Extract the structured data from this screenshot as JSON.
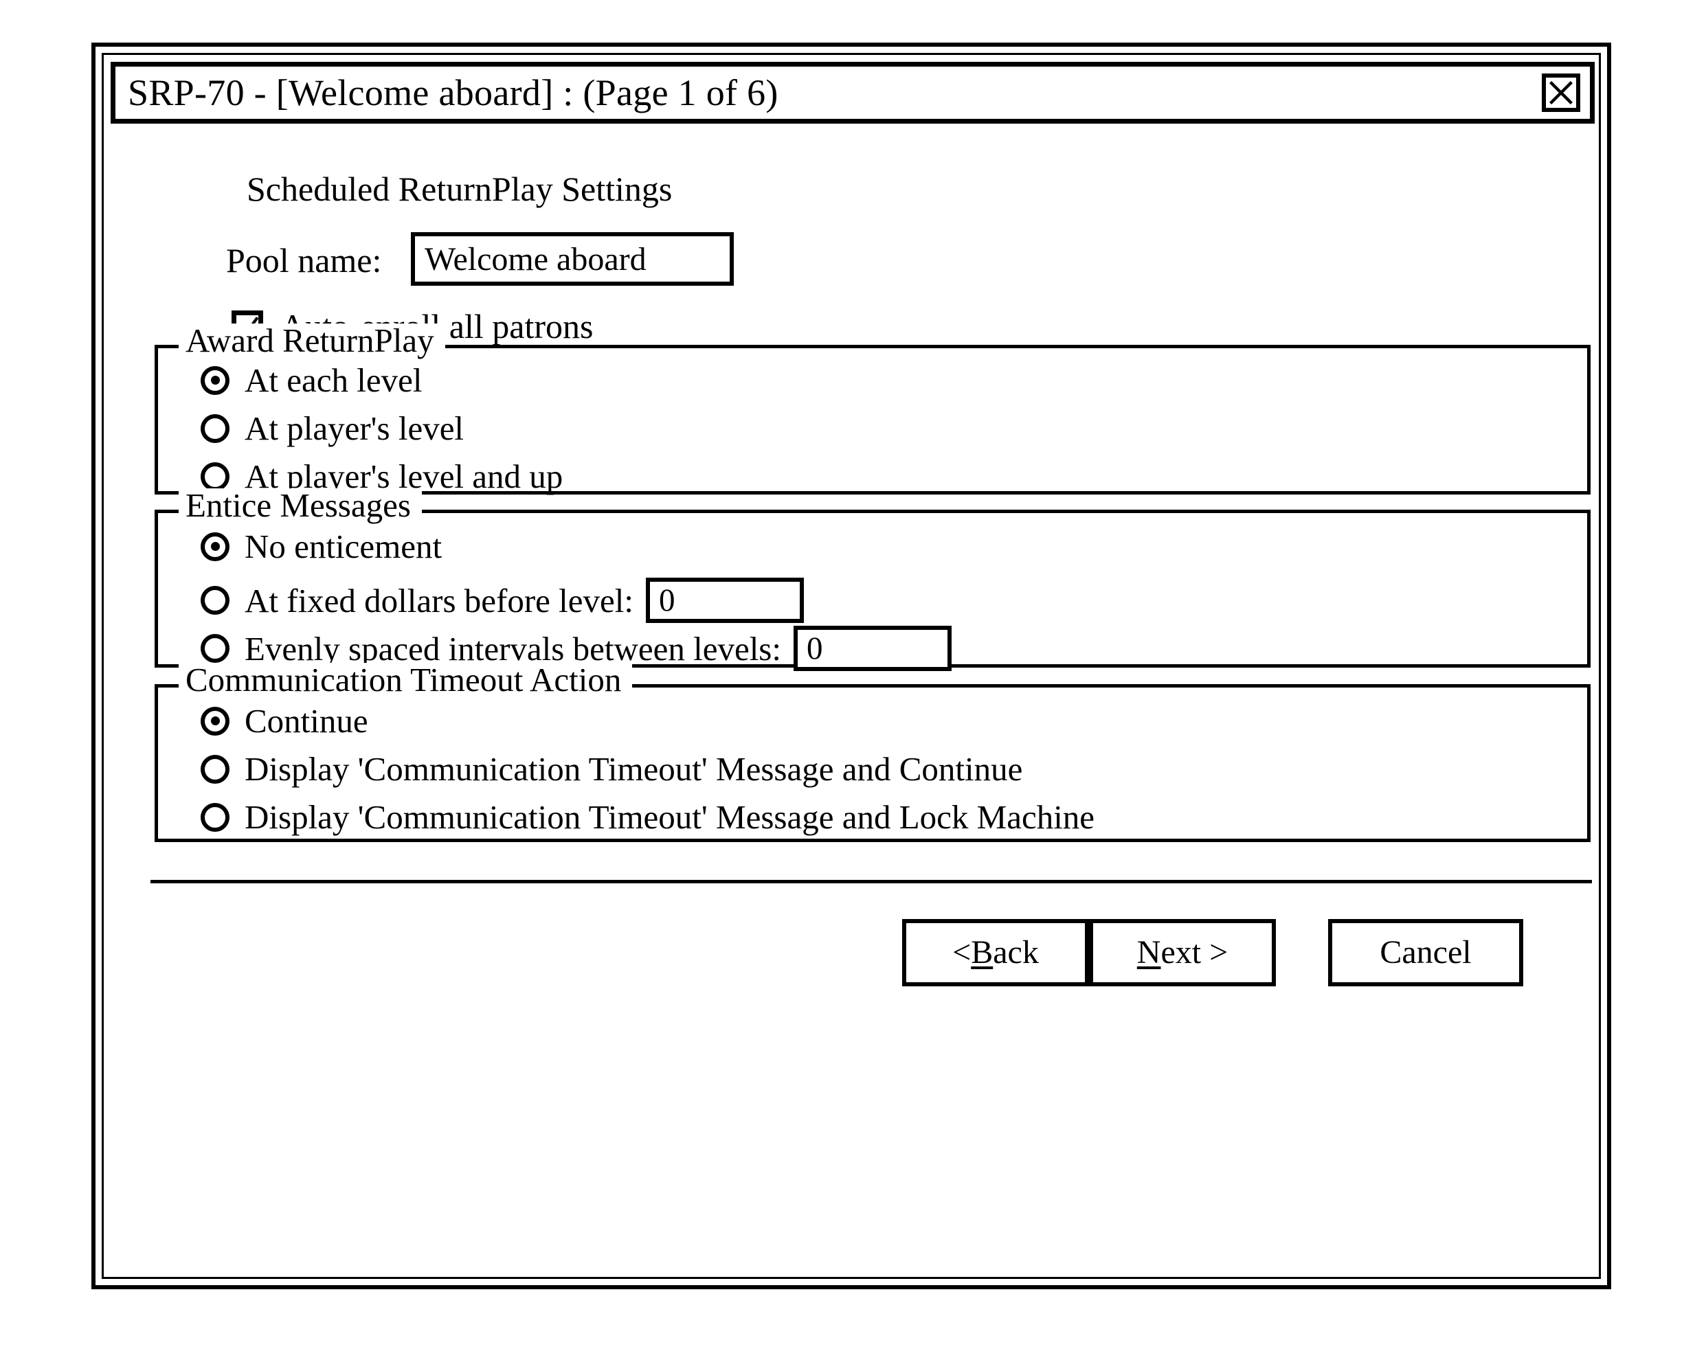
{
  "window": {
    "title": "SRP-70 - [Welcome aboard] : (Page 1 of 6)",
    "close_icon": "close-x-icon"
  },
  "heading": "Scheduled ReturnPlay Settings",
  "pool_name": {
    "label": "Pool name:",
    "value": "Welcome aboard"
  },
  "auto_enroll": {
    "label": "Auto-enroll all patrons",
    "checked": true,
    "icon": "checkmark-icon"
  },
  "groups": {
    "award": {
      "title": "Award ReturnPlay",
      "options": [
        {
          "label": "At each level",
          "selected": true
        },
        {
          "label": "At player's level",
          "selected": false
        },
        {
          "label": "At player's level and up",
          "selected": false
        }
      ]
    },
    "entice": {
      "title": "Entice Messages",
      "options": [
        {
          "label": "No enticement",
          "selected": true
        },
        {
          "label": "At fixed dollars before level:",
          "selected": false,
          "field_value": "0"
        },
        {
          "label": "Evenly spaced intervals between levels:",
          "selected": false,
          "field_value": "0"
        }
      ]
    },
    "timeout": {
      "title": "Communication Timeout Action",
      "options": [
        {
          "label": "Continue",
          "selected": true
        },
        {
          "label": "Display 'Communication Timeout' Message and Continue",
          "selected": false
        },
        {
          "label": "Display 'Communication Timeout' Message and Lock Machine",
          "selected": false
        }
      ]
    }
  },
  "buttons": {
    "back": {
      "prefix": "< ",
      "accel": "B",
      "suffix": "ack"
    },
    "next": {
      "prefix": "",
      "accel": "N",
      "suffix": "ext >"
    },
    "cancel": "Cancel"
  },
  "colors": {
    "ink": "#000000",
    "paper": "#ffffff"
  }
}
